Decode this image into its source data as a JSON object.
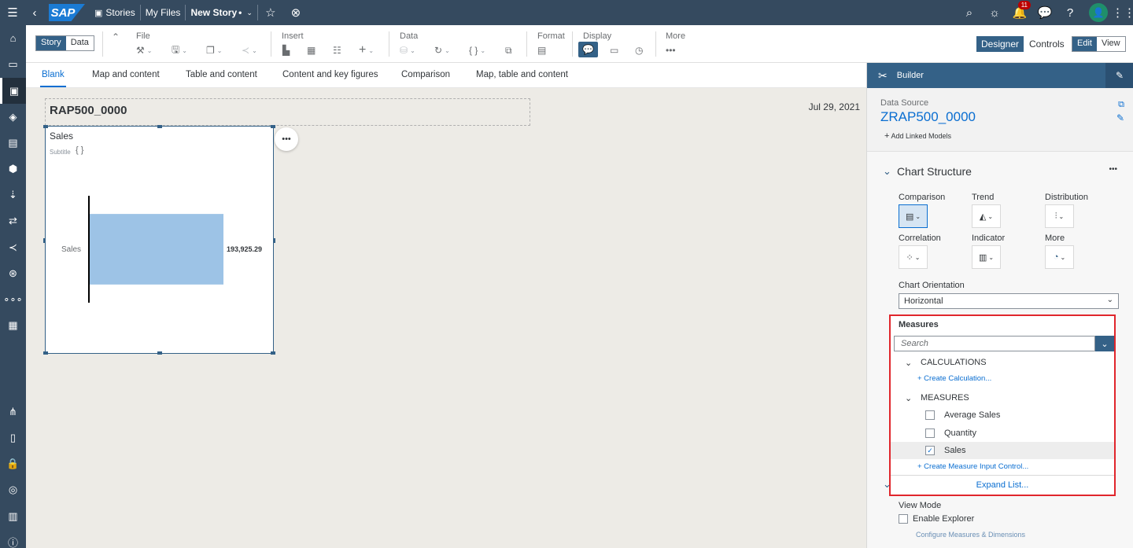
{
  "shell": {
    "logo": "SAP",
    "stories": "Stories",
    "my_files": "My Files",
    "story_name": "New Story",
    "story_modified_mark": "•",
    "notification_count": "11"
  },
  "toolbar": {
    "story_label": "Story",
    "data_label": "Data",
    "file_label": "File",
    "insert_label": "Insert",
    "data_group_label": "Data",
    "format_label": "Format",
    "display_label": "Display",
    "more_label": "More",
    "designer_label": "Designer",
    "controls_label": "Controls",
    "edit_label": "Edit",
    "view_label": "View"
  },
  "tabs": [
    "Blank",
    "Map and content",
    "Table and content",
    "Content and key figures",
    "Comparison",
    "Map, table and content"
  ],
  "canvas": {
    "story_title": "RAP500_0000",
    "date": "Jul 29, 2021",
    "tile_title": "Sales",
    "tile_subtitle": "Subtitle",
    "tile_subtitle_icon": "{ }"
  },
  "chart_data": {
    "type": "bar",
    "orientation": "horizontal",
    "categories": [
      "Sales"
    ],
    "values": [
      193925.29
    ],
    "value_labels": [
      "193,925.29"
    ],
    "title": "Sales",
    "subtitle": "",
    "bar_color": "#9dc3e6"
  },
  "builder": {
    "title": "Builder",
    "data_source_label": "Data Source",
    "data_source_name": "ZRAP500_0000",
    "add_linked_models": "Add Linked Models",
    "section_title": "Chart Structure",
    "categories": {
      "comparison": "Comparison",
      "trend": "Trend",
      "distribution": "Distribution",
      "correlation": "Correlation",
      "indicator": "Indicator",
      "more": "More"
    },
    "orientation_label": "Chart Orientation",
    "orientation_value": "Horizontal",
    "measures": {
      "title": "Measures",
      "search_placeholder": "Search",
      "calculations_group": "CALCULATIONS",
      "create_calculation": "+ Create Calculation...",
      "measures_group": "MEASURES",
      "items": [
        {
          "label": "Average Sales",
          "checked": false
        },
        {
          "label": "Quantity",
          "checked": false
        },
        {
          "label": "Sales",
          "checked": true
        }
      ],
      "create_input_control": "+ Create Measure Input Control...",
      "expand_list": "Expand List..."
    },
    "view_mode_label": "View Mode",
    "enable_explorer": "Enable Explorer",
    "configure_link": "Configure Measures & Dimensions"
  },
  "colors": {
    "shell_bg": "#354a5f",
    "accent": "#346187",
    "link": "#0a6ed1",
    "highlight_border": "#e0262c"
  }
}
